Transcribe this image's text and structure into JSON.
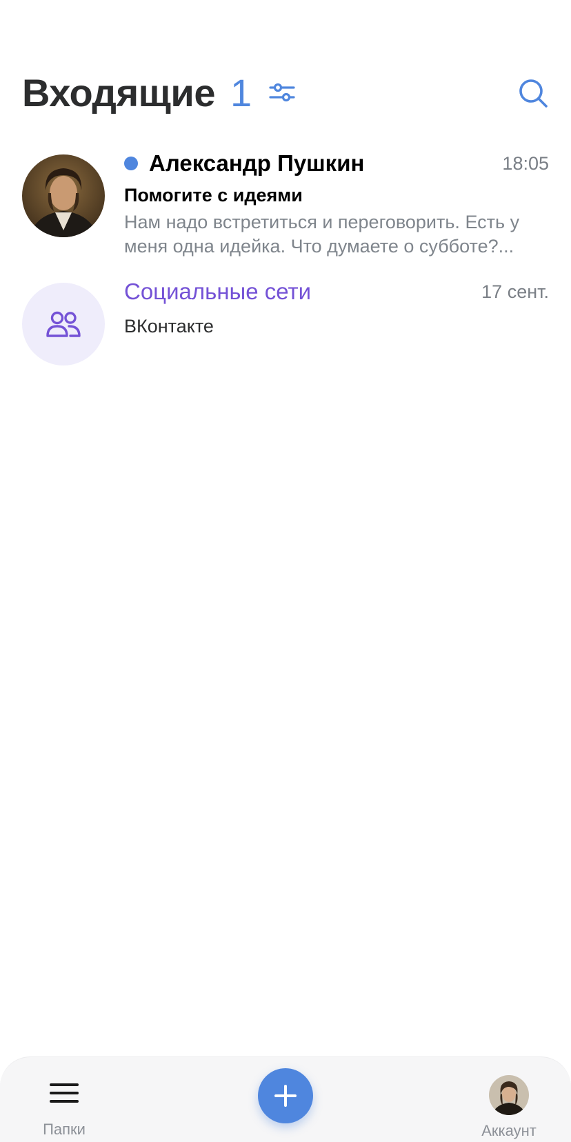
{
  "header": {
    "title": "Входящие",
    "unread_count": "1"
  },
  "messages": [
    {
      "unread": true,
      "sender": "Александр Пушкин",
      "time": "18:05",
      "subject": "Помогите с идеями",
      "snippet": "Нам надо встретиться и переговорить. Есть у меня одна идейка. Что думаете о субботе?..."
    },
    {
      "sender": "Социальные сети",
      "time": "17 сент.",
      "subtitle": "ВКонтакте"
    }
  ],
  "bottom_bar": {
    "folders_label": "Папки",
    "account_label": "Аккаунт"
  },
  "colors": {
    "accent": "#4f86de",
    "folder_purple": "#7452d6",
    "folder_bg": "#efedfb"
  }
}
